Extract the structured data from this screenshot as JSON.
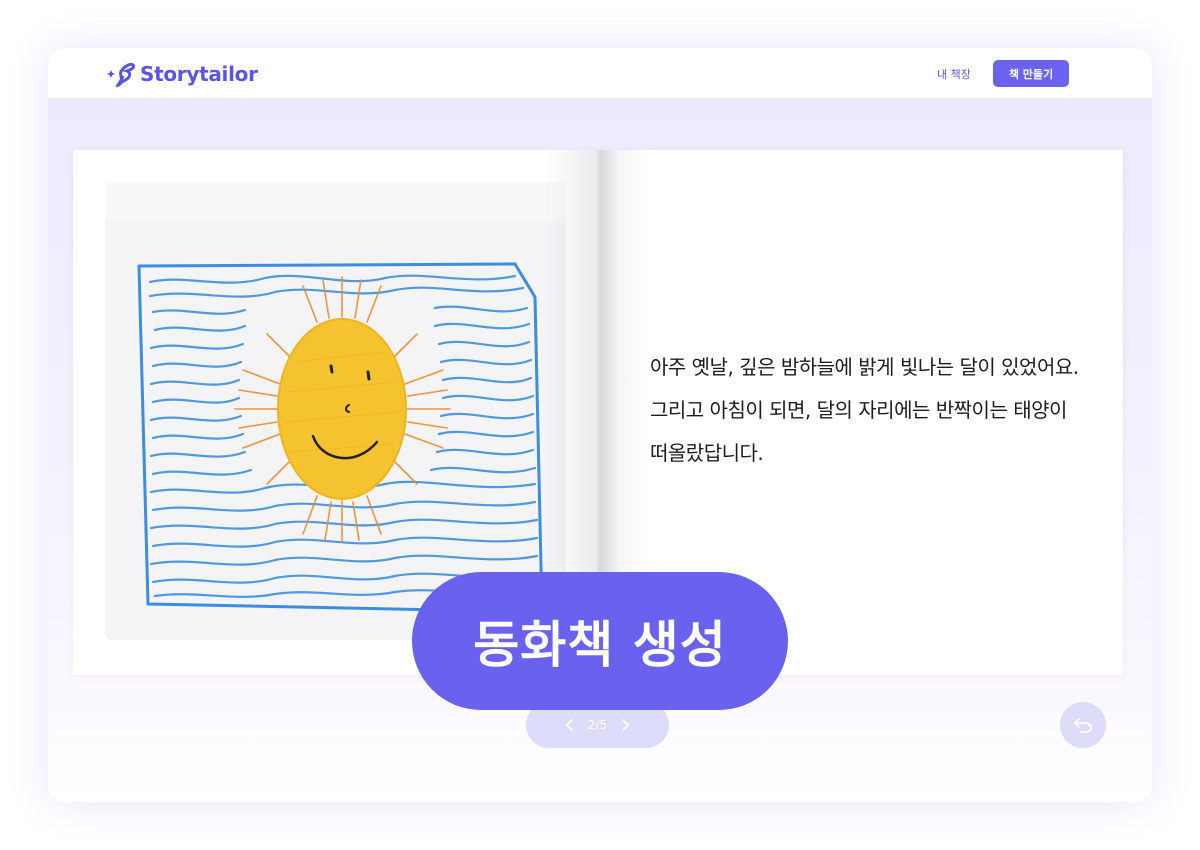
{
  "app": {
    "logo_text": "Storytailor"
  },
  "header": {
    "nav_link": "내 책장",
    "nav_button": "책 만들기"
  },
  "book": {
    "page_text": "아주 옛날, 깊은 밤하늘에 밝게 빛나는 달이 있었어요. 그리고 아침이 되면, 달의 자리에는 반짝이는 태양이 떠올랐답니다."
  },
  "action": {
    "generate_label": "동화책 생성"
  },
  "pager": {
    "indicator": "2/5",
    "current": 2,
    "total": 5
  },
  "icons": {
    "logo": "sparkle-feather-icon",
    "prev": "chevron-left-icon",
    "next": "chevron-right-icon",
    "back": "undo-icon"
  },
  "colors": {
    "brand": "#5b55e6",
    "button": "#6a62ef",
    "pager_bg": "#dedcfb",
    "background": "#ebeafd"
  }
}
